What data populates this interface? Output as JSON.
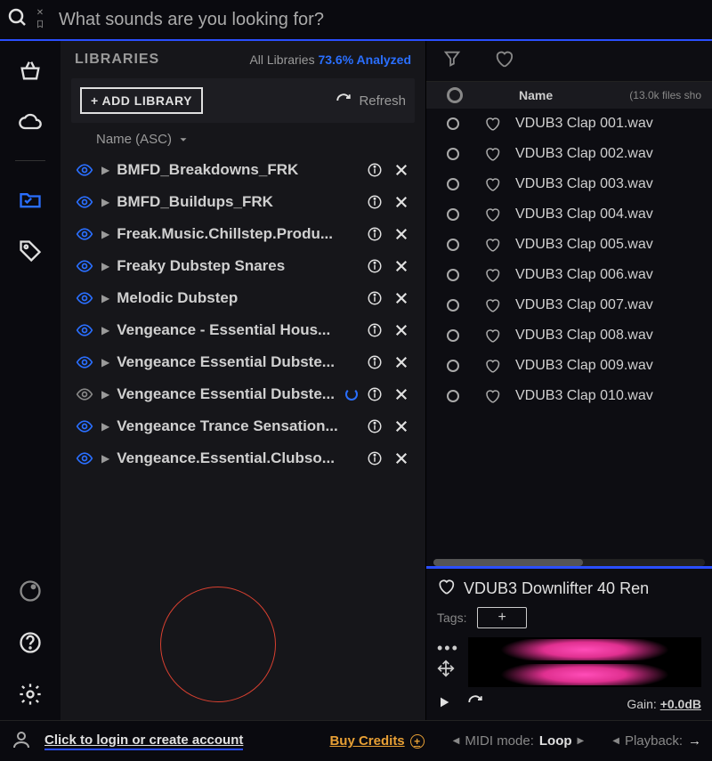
{
  "search": {
    "placeholder": "What sounds are you looking for?"
  },
  "libraries": {
    "title": "LIBRARIES",
    "all_label": "All Libraries",
    "analyzed_pct": "73.6% Analyzed",
    "add_button": "+ ADD LIBRARY",
    "refresh": "Refresh",
    "sort_label": "Name (ASC)",
    "items": [
      {
        "name": "BMFD_Breakdowns_FRK",
        "visible": true,
        "loading": false
      },
      {
        "name": "BMFD_Buildups_FRK",
        "visible": true,
        "loading": false
      },
      {
        "name": "Freak.Music.Chillstep.Produ...",
        "visible": true,
        "loading": false
      },
      {
        "name": "Freaky Dubstep Snares",
        "visible": true,
        "loading": false
      },
      {
        "name": "Melodic Dubstep",
        "visible": true,
        "loading": false
      },
      {
        "name": "Vengeance - Essential Hous...",
        "visible": true,
        "loading": false
      },
      {
        "name": "Vengeance Essential Dubste...",
        "visible": true,
        "loading": false
      },
      {
        "name": "Vengeance Essential Dubste...",
        "visible": false,
        "loading": true
      },
      {
        "name": "Vengeance Trance Sensation...",
        "visible": true,
        "loading": false
      },
      {
        "name": "Vengeance.Essential.Clubso...",
        "visible": true,
        "loading": false
      }
    ]
  },
  "files": {
    "name_header": "Name",
    "count_label": "(13.0k files sho",
    "items": [
      {
        "name": "VDUB3 Clap 001.wav"
      },
      {
        "name": "VDUB3 Clap 002.wav"
      },
      {
        "name": "VDUB3 Clap 003.wav"
      },
      {
        "name": "VDUB3 Clap 004.wav"
      },
      {
        "name": "VDUB3 Clap 005.wav"
      },
      {
        "name": "VDUB3 Clap 006.wav"
      },
      {
        "name": "VDUB3 Clap 007.wav"
      },
      {
        "name": "VDUB3 Clap 008.wav"
      },
      {
        "name": "VDUB3 Clap 009.wav"
      },
      {
        "name": "VDUB3 Clap 010.wav"
      }
    ]
  },
  "preview": {
    "title": "VDUB3 Downlifter 40 Ren",
    "tags_label": "Tags:",
    "add_tag": "+",
    "gain_label": "Gain:",
    "gain_value": "+0.0dB"
  },
  "footer": {
    "login": "Click to login or create account",
    "buy_credits": "Buy Credits",
    "midi_label": "MIDI mode:",
    "midi_value": "Loop",
    "playback_label": "Playback:"
  }
}
